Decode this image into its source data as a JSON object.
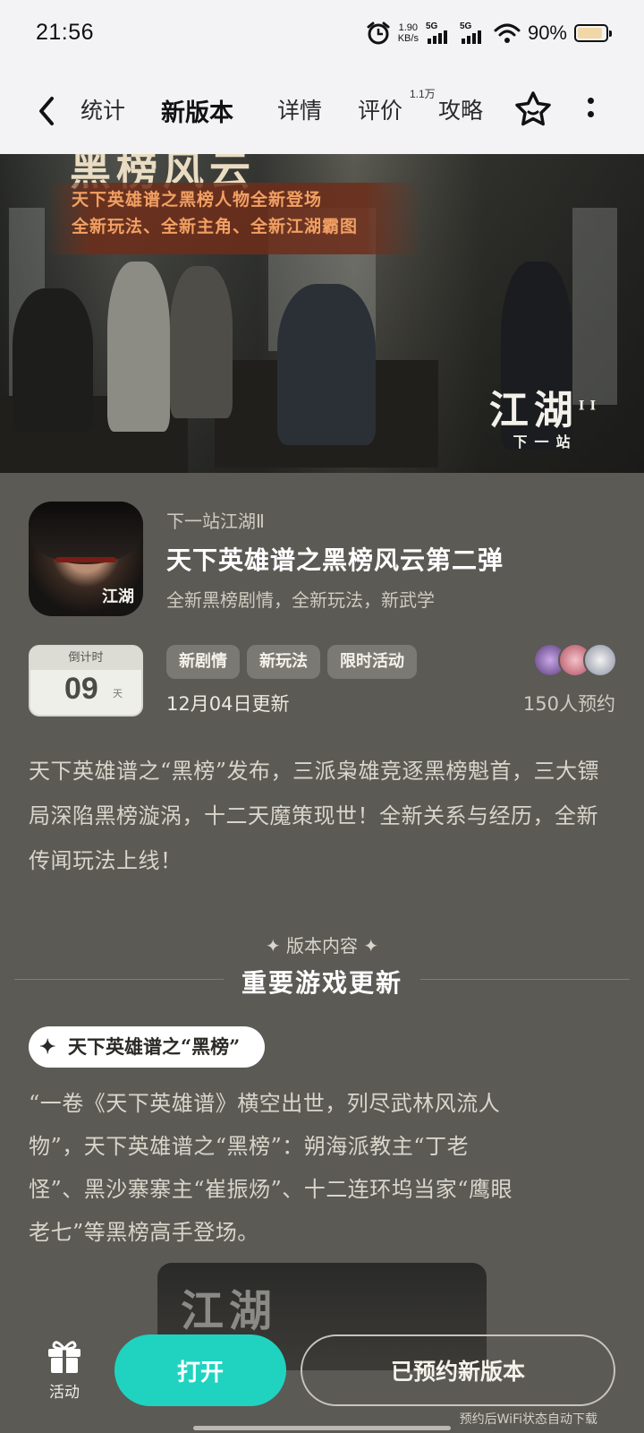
{
  "status_bar": {
    "time": "21:56",
    "net_speed_value": "1.90",
    "net_speed_unit": "KB/s",
    "sim1": "5G",
    "sim2": "5G",
    "battery_percent": "90%",
    "battery_level": 0.9
  },
  "nav": {
    "tabs": [
      {
        "label": "统计"
      },
      {
        "label": "新版本"
      },
      {
        "label": "详情"
      },
      {
        "label": "评价"
      },
      {
        "label": "攻略"
      }
    ],
    "active_tab": "新版本",
    "review_badge": "1.1万",
    "accent_color": "#22d3c3"
  },
  "banner": {
    "title": "黑榜风云",
    "slogan_line1": "天下英雄谱之黑榜人物全新登场",
    "slogan_line2": "全新玩法、全新主角、全新江湖霸图",
    "logo": "江湖",
    "logo_sub": "下一站",
    "logo_mark": "II"
  },
  "game": {
    "icon_tag": "江湖",
    "name": "下一站江湖Ⅱ",
    "update_title": "天下英雄谱之黑榜风云第二弹",
    "update_desc": "全新黑榜剧情，全新玩法，新武学"
  },
  "countdown": {
    "label": "倒计时",
    "value": "09",
    "unit": "天"
  },
  "tags": [
    "新剧情",
    "新玩法",
    "限时活动"
  ],
  "update_date": "12月04日更新",
  "reservations": "150人预约",
  "intro": "天下英雄谱之“黑榜”发布，三派枭雄竞逐黑榜魁首，三大镖局深陷黑榜漩涡，十二天魔策现世！全新关系与经历，全新传闻玩法上线！",
  "section": {
    "label": "✦ 版本内容 ✦",
    "title": "重要游戏更新"
  },
  "feature": {
    "pill": "天下英雄谱之“黑榜”",
    "line1": "“一卷《天下英雄谱》横空出世，列尽武林风流人",
    "line2": "物”，天下英雄谱之“黑榜”：朔海派教主“丁老",
    "line3": "怪”、黑沙寨寨主“崔振炀”、十二连环坞当家“鹰眼",
    "line4": "老七”等黑榜高手登场。",
    "thumb_logo": "江湖"
  },
  "bottom": {
    "activity_label": "活动",
    "open_button": "打开",
    "reserved_button": "已预约新版本",
    "wifi_note": "预约后WiFi状态自动下载"
  }
}
